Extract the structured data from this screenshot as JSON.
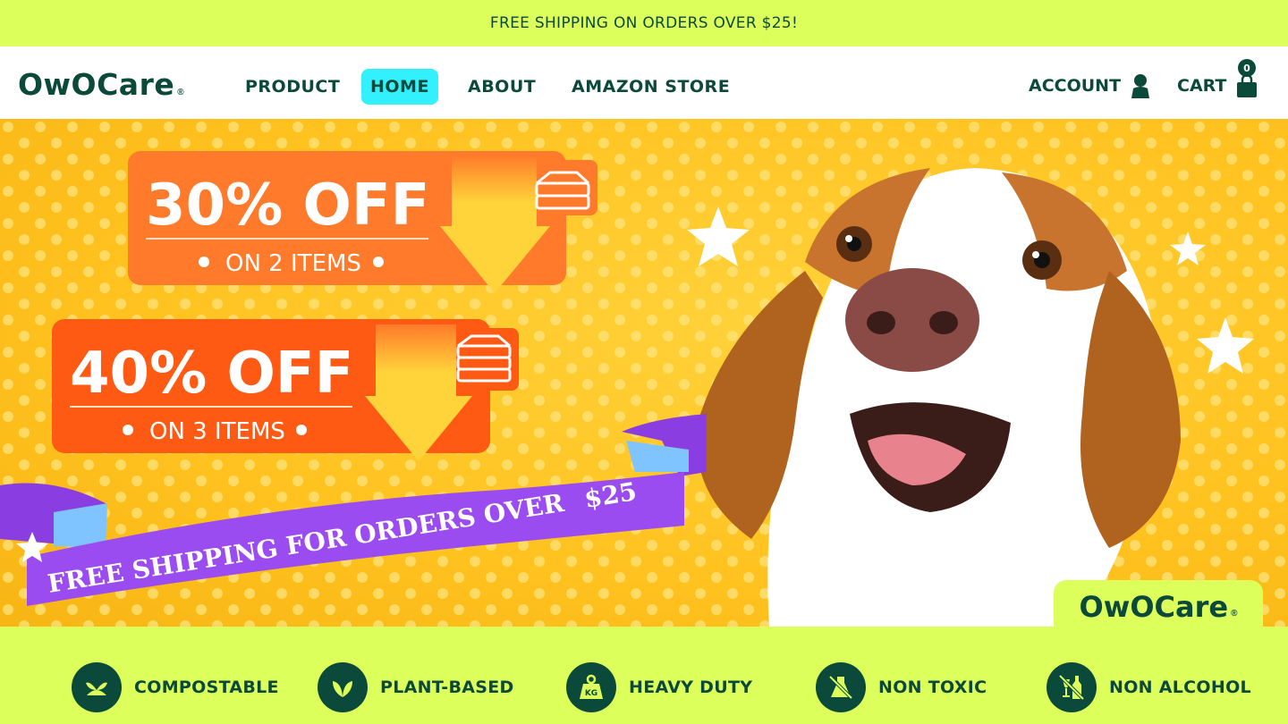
{
  "announcement": "FREE SHIPPING ON ORDERS OVER $25!",
  "brand": {
    "name": "OwOCare",
    "registered": "®"
  },
  "nav": {
    "items": [
      {
        "label": "PRODUCT"
      },
      {
        "label": "HOME",
        "active": true
      },
      {
        "label": "ABOUT"
      },
      {
        "label": "AMAZON STORE"
      }
    ],
    "account_label": "ACCOUNT",
    "cart_label": "CART",
    "cart_count": "0"
  },
  "hero": {
    "offer1": {
      "headline": "30% OFF",
      "sub": "ON 2 ITEMS"
    },
    "offer2": {
      "headline": "40% OFF",
      "sub": "ON 3 ITEMS"
    },
    "ribbon_text": "FREE SHIPPING FOR ORDERS OVER",
    "ribbon_amount": "$25",
    "logo": "OwOCare"
  },
  "features": [
    {
      "label": "COMPOSTABLE",
      "icon": "compost-icon"
    },
    {
      "label": "PLANT-BASED",
      "icon": "leaf-icon"
    },
    {
      "label": "HEAVY DUTY",
      "icon": "weight-kg-icon"
    },
    {
      "label": "NON TOXIC",
      "icon": "no-toxic-icon"
    },
    {
      "label": "NON ALCOHOL",
      "icon": "no-alcohol-icon"
    }
  ],
  "colors": {
    "brand_green": "#0b4a3a",
    "lime": "#ddff5c",
    "cyan_active": "#33f0ff",
    "hero_yellow": "#ffc21f",
    "offer_orange": "#ff7a2a",
    "offer_red_orange": "#ff5a14",
    "ribbon_purple": "#9b4cf0"
  }
}
